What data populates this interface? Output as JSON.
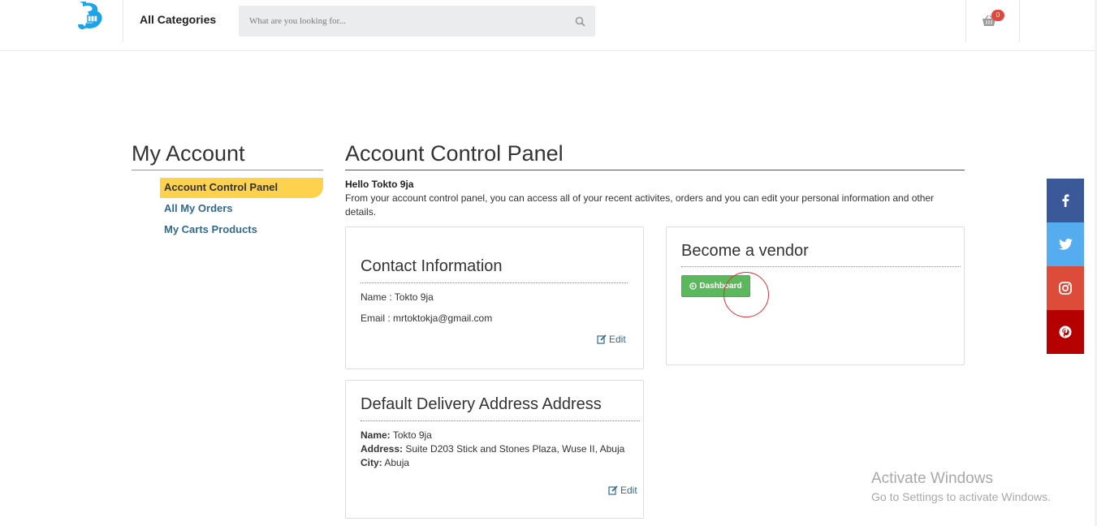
{
  "header": {
    "all_categories": "All Categories",
    "search_placeholder": "What are you looking for...",
    "cart_count": "0"
  },
  "sidebar": {
    "title": "My Account",
    "items": [
      {
        "label": "Account Control Panel",
        "active": true
      },
      {
        "label": "All My Orders",
        "active": false
      },
      {
        "label": "My Carts Products",
        "active": false
      }
    ]
  },
  "main": {
    "title": "Account Control Panel",
    "greeting": "Hello Tokto 9ja",
    "intro": "From your account control panel, you can access all of your recent activites, orders and you can edit your personal information and other details."
  },
  "contact": {
    "title": "Contact Information",
    "name_line": "Name : Tokto 9ja",
    "email_line": "Email : mrtoktokja@gmail.com",
    "edit_label": "Edit"
  },
  "vendor": {
    "title": "Become a vendor",
    "button_label": "Dashboard"
  },
  "address": {
    "title": "Default Delivery Address Address",
    "name_label": "Name:",
    "name_value": "Tokto 9ja",
    "address_label": "Address:",
    "address_value": "Suite D203 Stick and Stones Plaza, Wuse II, Abuja",
    "city_label": "City:",
    "city_value": "Abuja",
    "edit_label": "Edit"
  },
  "social": [
    {
      "icon": "facebook-icon",
      "color": "#3b5998"
    },
    {
      "icon": "twitter-icon",
      "color": "#55acee"
    },
    {
      "icon": "instagram-icon",
      "color": "#dd4b39"
    },
    {
      "icon": "pinterest-icon",
      "color": "#b40000"
    }
  ],
  "watermark": {
    "line1": "Activate Windows",
    "line2": "Go to Settings to activate Windows."
  },
  "colors": {
    "accent_yellow": "#ffd24d",
    "link_blue": "#31698f",
    "success_green": "#5cb85c",
    "badge_red": "#e2473b"
  }
}
